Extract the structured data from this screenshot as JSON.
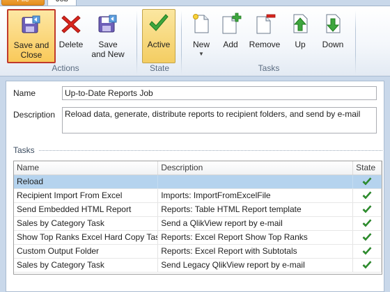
{
  "tabs": {
    "file": "File",
    "job": "Job"
  },
  "ribbon": {
    "actions": {
      "label": "Actions",
      "save_and_close": "Save and Close",
      "delete": "Delete",
      "save_and_new": "Save and New"
    },
    "state": {
      "label": "State",
      "active": "Active"
    },
    "tasks": {
      "label": "Tasks",
      "new": "New",
      "add": "Add",
      "remove": "Remove",
      "up": "Up",
      "down": "Down"
    }
  },
  "form": {
    "name_label": "Name",
    "name_value": "Up-to-Date Reports Job",
    "description_label": "Description",
    "description_value": "Reload data, generate, distribute reports to recipient folders, and send by e-mail",
    "tasks_heading": "Tasks"
  },
  "grid": {
    "columns": [
      "Name",
      "Description",
      "State"
    ],
    "rows": [
      {
        "name": "Reload",
        "description": "",
        "state": "enabled"
      },
      {
        "name": "Recipient Import From Excel",
        "description": "Imports: ImportFromExcelFile",
        "state": "enabled"
      },
      {
        "name": "Send Embedded HTML Report",
        "description": "Reports: Table HTML Report template",
        "state": "enabled"
      },
      {
        "name": "Sales by Category Task",
        "description": "Send a QlikView report by e-mail",
        "state": "enabled"
      },
      {
        "name": "Show Top Ranks Excel Hard Copy Task",
        "description": "Reports: Excel Report Show Top Ranks",
        "state": "enabled"
      },
      {
        "name": "Custom Output Folder",
        "description": "Reports: Excel Report with Subtotals",
        "state": "enabled"
      },
      {
        "name": "Sales by Category Task",
        "description": "Send Legacy QlikView report by e-mail",
        "state": "enabled"
      }
    ],
    "selected_row": 0
  },
  "colors": {
    "accent_orange": "#e58d1a",
    "selection_blue": "#b5d3ee",
    "check_green": "#2e9b2e",
    "highlight_red": "#c0392b"
  },
  "icons": {
    "save_and_close": "save-disk-icon",
    "delete": "red-x-icon",
    "save_and_new": "save-new-icon",
    "active": "green-check-icon",
    "new": "new-document-icon",
    "add": "add-document-icon",
    "remove": "remove-document-icon",
    "up": "arrow-up-icon",
    "down": "arrow-down-icon",
    "state_cell": "green-check-icon"
  }
}
